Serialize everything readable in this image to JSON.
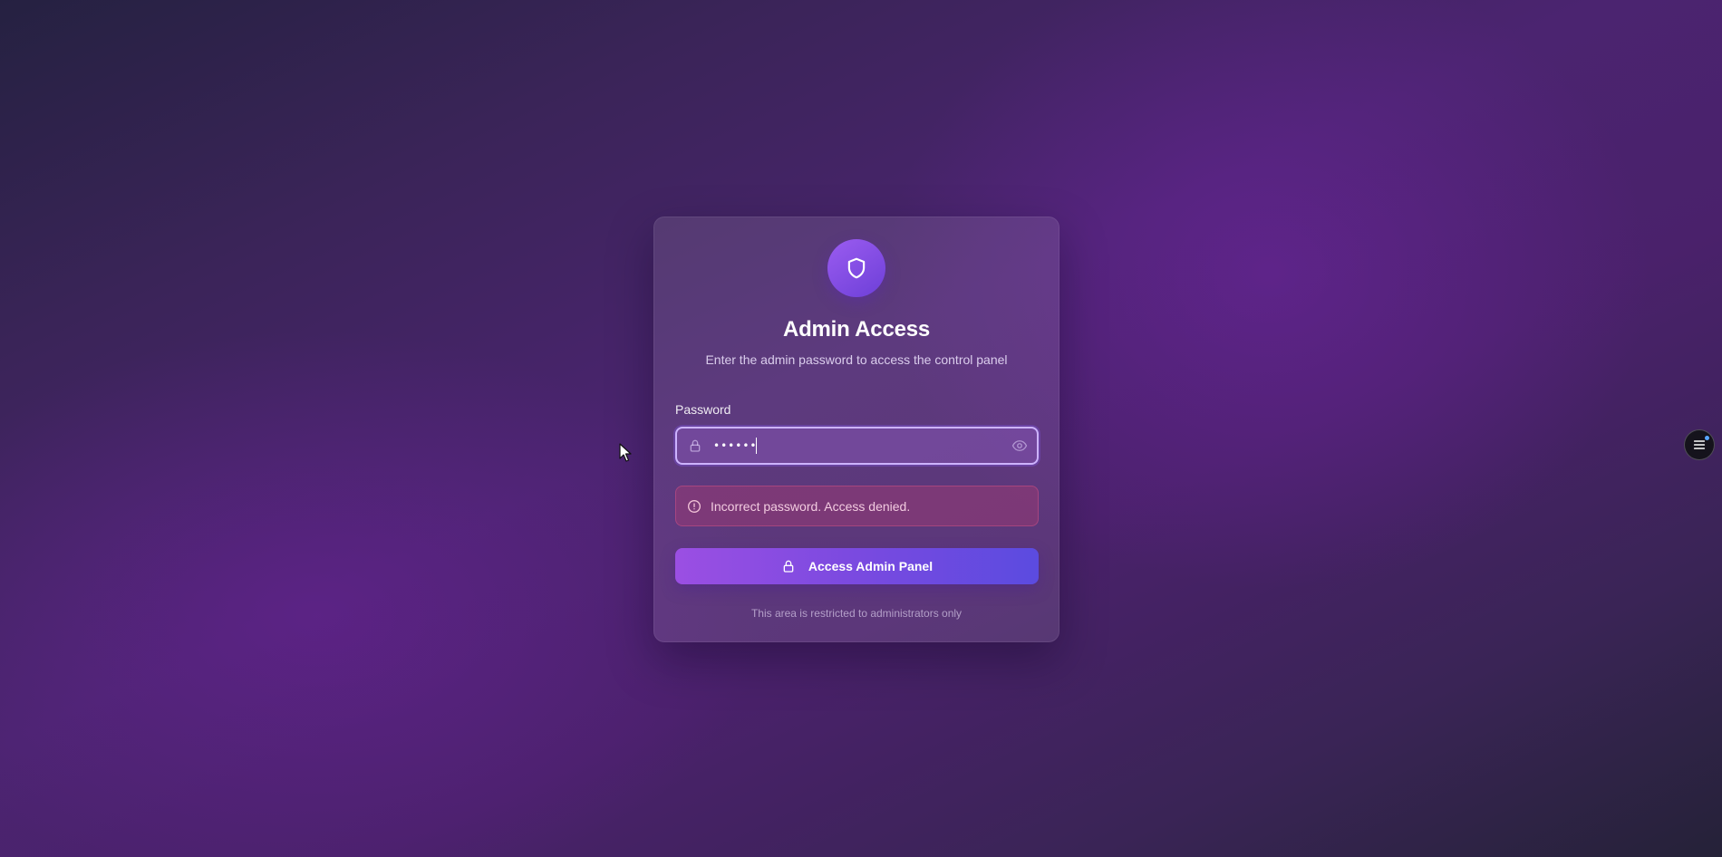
{
  "colors": {
    "accent": "#7a4ae0",
    "badge": "#8a50ea",
    "error": "#c83c6e",
    "focus_ring": "#cdb3ff"
  },
  "card": {
    "badge_icon": "shield-icon",
    "title": "Admin Access",
    "subtitle": "Enter the admin password to access the control panel",
    "password_label": "Password",
    "password_value": "••••••",
    "password_leading_icon": "lock-icon",
    "password_trailing_icon": "eye-icon",
    "error": {
      "icon": "alert-circle-icon",
      "message": "Incorrect password. Access denied."
    },
    "submit": {
      "icon": "lock-icon",
      "label": "Access Admin Panel"
    },
    "footer_note": "This area is restricted to administrators only"
  },
  "floating_menu": {
    "icon": "menu-icon"
  }
}
